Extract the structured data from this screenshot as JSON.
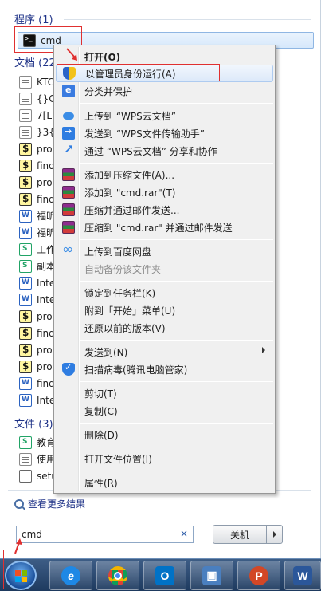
{
  "categories": {
    "programs": "程序 (1)",
    "documents": "文档 (22",
    "files": "文件 (3)"
  },
  "program_result": {
    "label": "cmd",
    "icon": "cmd-icon"
  },
  "document_results": [
    {
      "label": "KTC",
      "icon": "text-file-icon"
    },
    {
      "label": "{}CM",
      "icon": "text-file-icon"
    },
    {
      "label": "7[LI",
      "icon": "text-file-icon"
    },
    {
      "label": "}3{C",
      "icon": "text-file-icon"
    },
    {
      "label": "pro",
      "icon": "powershell-icon"
    },
    {
      "label": "find",
      "icon": "powershell-icon"
    },
    {
      "label": "pro",
      "icon": "powershell-icon"
    },
    {
      "label": "find",
      "icon": "powershell-icon"
    },
    {
      "label": "福昕",
      "icon": "word-doc-icon"
    },
    {
      "label": "福昕",
      "icon": "word-doc-icon"
    },
    {
      "label": "工作",
      "icon": "spreadsheet-icon"
    },
    {
      "label": "副本",
      "icon": "spreadsheet-icon"
    },
    {
      "label": "Inte",
      "icon": "word-doc-icon"
    },
    {
      "label": "Inte",
      "icon": "word-doc-icon"
    },
    {
      "label": "pro",
      "icon": "powershell-icon"
    },
    {
      "label": "find",
      "icon": "powershell-icon"
    },
    {
      "label": "pro",
      "icon": "powershell-icon"
    },
    {
      "label": "pro",
      "icon": "powershell-icon"
    },
    {
      "label": "find",
      "icon": "word-doc-icon"
    },
    {
      "label": "Inte",
      "icon": "word-doc-icon"
    }
  ],
  "file_results": [
    {
      "label": "教育",
      "icon": "spreadsheet-icon"
    },
    {
      "label": "使用",
      "icon": "text-file-icon"
    },
    {
      "label": "setu",
      "icon": "generic-file-icon"
    }
  ],
  "context_menu": {
    "open": "打开(O)",
    "run_as_admin": "以管理员身份运行(A)",
    "classify_protect": "分类并保护",
    "upload_wps": "上传到 “WPS云文档”",
    "send_wps_helper": "发送到 “WPS文件传输助手”",
    "share_wps": "通过 “WPS云文档” 分享和协作",
    "add_archive": "添加到压缩文件(A)...",
    "add_cmd_rar": "添加到 \"cmd.rar\"(T)",
    "compress_email": "压缩并通过邮件发送...",
    "compress_cmd_rar_email": "压缩到 \"cmd.rar\" 并通过邮件发送",
    "upload_baidu": "上传到百度网盘",
    "auto_backup": "自动备份该文件夹",
    "pin_taskbar": "锁定到任务栏(K)",
    "pin_start": "附到「开始」菜单(U)",
    "restore_previous": "还原以前的版本(V)",
    "send_to": "发送到(N)",
    "scan_virus": "扫描病毒(腾讯电脑管家)",
    "cut": "剪切(T)",
    "copy": "复制(C)",
    "delete": "删除(D)",
    "open_location": "打开文件位置(I)",
    "properties": "属性(R)"
  },
  "more_results": "查看更多结果",
  "search": {
    "value": "cmd",
    "clear_glyph": "×"
  },
  "shutdown": {
    "label": "关机"
  },
  "taskbar": {
    "apps": [
      "Internet Explorer",
      "Chrome",
      "Outlook",
      "Remote Desktop",
      "PowerPoint",
      "Word"
    ]
  },
  "colors": {
    "category_header": "#1e3287",
    "highlight_border": "#e03030",
    "taskbar": "#2a4a74"
  }
}
